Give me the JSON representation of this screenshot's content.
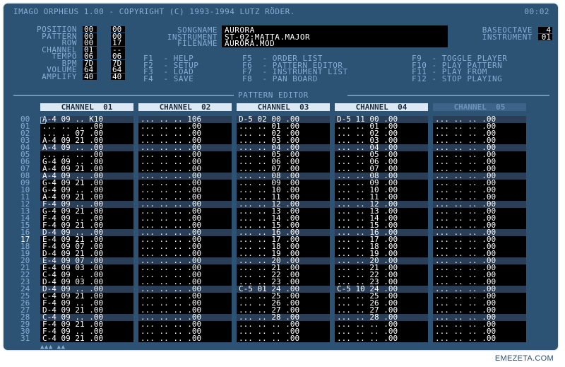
{
  "window": {
    "title": "IMAGO ORPHEUS 1.00 - COPYRIGHT (C) 1993-1994 LUTZ RÖDER.",
    "clock": "00:02"
  },
  "status": {
    "labels": [
      "POSITION",
      "PATTERN",
      "ROW",
      "CHANNEL",
      "TEMPO",
      "BPM",
      "VOLUME",
      "AMPLIFY"
    ],
    "col1": [
      "00",
      "00",
      "00",
      "01",
      "06",
      "7D",
      "64",
      "40"
    ],
    "col2": [
      "00",
      "00",
      "17",
      "--",
      "06",
      "7D",
      "64",
      "40"
    ]
  },
  "song": {
    "labels": [
      "SONGNAME",
      "INSTRUMENT",
      "FILENAME"
    ],
    "values": [
      "AURORA",
      "ST-02:MATTA.MAJOR",
      "AURORA.MOD"
    ]
  },
  "octave": {
    "labels": [
      "BASEOCTAVE",
      "INSTRUMENT"
    ],
    "values": [
      "4",
      "01"
    ]
  },
  "keys": [
    [
      "F1  - HELP",
      "F2  - SETUP",
      "F3  - LOAD",
      "F4  - SAVE"
    ],
    [
      "F5  - ORDER LIST",
      "F6  - PATTERN EDITOR",
      "F7  - INSTRUMENT LIST",
      "F8  - PAN BOARD"
    ],
    [
      "F9  - TOGGLE PLAYER",
      "F10 - PLAY PATTERN",
      "F11 - PLAY FROM",
      "F12 - STOP PLAYING"
    ]
  ],
  "section_title": "PATTERN EDITOR",
  "channels": [
    "CHANNEL  01",
    "CHANNEL  02",
    "CHANNEL  03",
    "CHANNEL  04",
    "CHANNEL  05"
  ],
  "row_numbers": [
    "00",
    "01",
    "02",
    "03",
    "04",
    "05",
    "06",
    "07",
    "08",
    "09",
    "10",
    "11",
    "12",
    "13",
    "14",
    "15",
    "16",
    "17",
    "18",
    "19",
    "20",
    "21",
    "22",
    "23",
    "24",
    "25",
    "26",
    "27",
    "28",
    "29",
    "30",
    "31"
  ],
  "current_row": "17",
  "pattern": {
    "ch1": [
      "A-4 09 .. K10",
      "... .. .. .00",
      "... .. 07 .00",
      "A-4 09 21 .00",
      "A-4 09 .. .00",
      "... .. .. .00",
      "G-4 09 .. .00",
      "A-4 09 21 .00",
      "A-4 09 .. .00",
      "G-4 09 21 .00",
      "G-4 09 .. .00",
      "A-4 09 21 .00",
      "F-4 09 .. .00",
      "G-4 09 21 .00",
      "F-4 09 .. .00",
      "F-4 09 21 .00",
      "D-4 09 .. .00",
      "E-4 09 21 .00",
      "F-4 09 07 .00",
      "D-4 09 21 .00",
      "E-4 09 07 .00",
      "E-4 09 03 .00",
      "C-4 09 .. .00",
      "D-4 09 03 .00",
      "D-4 09 .. .00",
      "C-4 09 21 .00",
      "F-4 09 .. .00",
      "D-4 09 21 .00",
      "C-4 09 .. .00",
      "F-4 09 21 .00",
      "F-4 09 .. .00",
      "C-4 09 21 .00"
    ],
    "ch2": [
      "... .. .. 106",
      "... .. .. .00",
      "... .. .. .00",
      "... .. .. .00",
      "... .. .. .00",
      "... .. .. .00",
      "... .. .. .00",
      "... .. .. .00",
      "... .. .. .00",
      "... .. .. .00",
      "... .. .. .00",
      "... .. .. .00",
      "... .. .. .00",
      "... .. .. .00",
      "... .. .. .00",
      "... .. .. .00",
      "... .. .. .00",
      "... .. .. .00",
      "... .. .. .00",
      "... .. .. .00",
      "... .. .. .00",
      "... .. .. .00",
      "... .. .. .00",
      "... .. .. .00",
      "... .. .. .00",
      "... .. .. .00",
      "... .. .. .00",
      "... .. .. .00",
      "... .. .. .00",
      "... .. .. .00",
      "... .. .. .00",
      "... .. .. .00"
    ],
    "ch3": [
      "D-5 02 00 .00",
      "... .. 01 .00",
      "... .. 02 .00",
      "... .. 03 .00",
      "... .. 04 .00",
      "... .. 05 .00",
      "... .. 06 .00",
      "... .. 07 .00",
      "... .. 08 .00",
      "... .. 09 .00",
      "... .. 10 .00",
      "... .. 11 .00",
      "... .. 12 .00",
      "... .. 13 .00",
      "... .. 14 .00",
      "... .. 15 .00",
      "... .. 16 .00",
      "... .. 17 .00",
      "... .. 18 .00",
      "... .. 19 .00",
      "... .. 20 .00",
      "... .. 21 .00",
      "... .. 22 .00",
      "... .. 23 .00",
      "C-5 01 24 .00",
      "... .. 25 .00",
      "... .. 26 .00",
      "... .. 27 .00",
      "... .. 28 .00",
      "... .. .. .00",
      "... .. .. .00",
      "... .. .. .00"
    ],
    "ch4": [
      "D-5 11 00 .00",
      "... .. 01 .00",
      "... .. 02 .00",
      "... .. 03 .00",
      "... .. 04 .00",
      "... .. 05 .00",
      "... .. 06 .00",
      "... .. 07 .00",
      "... .. 08 .00",
      "... .. 09 .00",
      "... .. 10 .00",
      "... .. 11 .00",
      "... .. 12 .00",
      "... .. 13 .00",
      "... .. 14 .00",
      "... .. 15 .00",
      "... .. 16 .00",
      "... .. 17 .00",
      "... .. 18 .00",
      "... .. 19 .00",
      "... .. 20 .00",
      "... .. 21 .00",
      "... .. 22 .00",
      "... .. 23 .00",
      "C-5 10 24 .00",
      "... .. 25 .00",
      "... .. 26 .00",
      "... .. 27 .00",
      "... .. 28 .00",
      "... .. .. .00",
      "... .. .. .00",
      "... .. .. .00"
    ],
    "ch5": [
      "... .. .. .00",
      "... .. .. .00",
      "... .. .. .00",
      "... .. .. .00",
      "... .. .. .00",
      "... .. .. .00",
      "... .. .. .00",
      "... .. .. .00",
      "... .. .. .00",
      "... .. .. .00",
      "... .. .. .00",
      "... .. .. .00",
      "... .. .. .00",
      "... .. .. .00",
      "... .. .. .00",
      "... .. .. .00",
      "... .. .. .00",
      "... .. .. .00",
      "... .. .. .00",
      "... .. .. .00",
      "... .. .. .00",
      "... .. .. .00",
      "... .. .. .00",
      "... .. .. .00",
      "... .. .. .00",
      "... .. .. .00",
      "... .. .. .00",
      "... .. .. .00",
      "... .. .. .00",
      "... .. .. .00",
      "... .. .. .00",
      "... .. .. .00"
    ]
  },
  "scroll_marks": "▲▲▲ ▲▲",
  "watermark": "EMEZETA.COM",
  "colors": {
    "background": "#2c5274",
    "label": "#86aed3",
    "header": "#dce8f4"
  }
}
